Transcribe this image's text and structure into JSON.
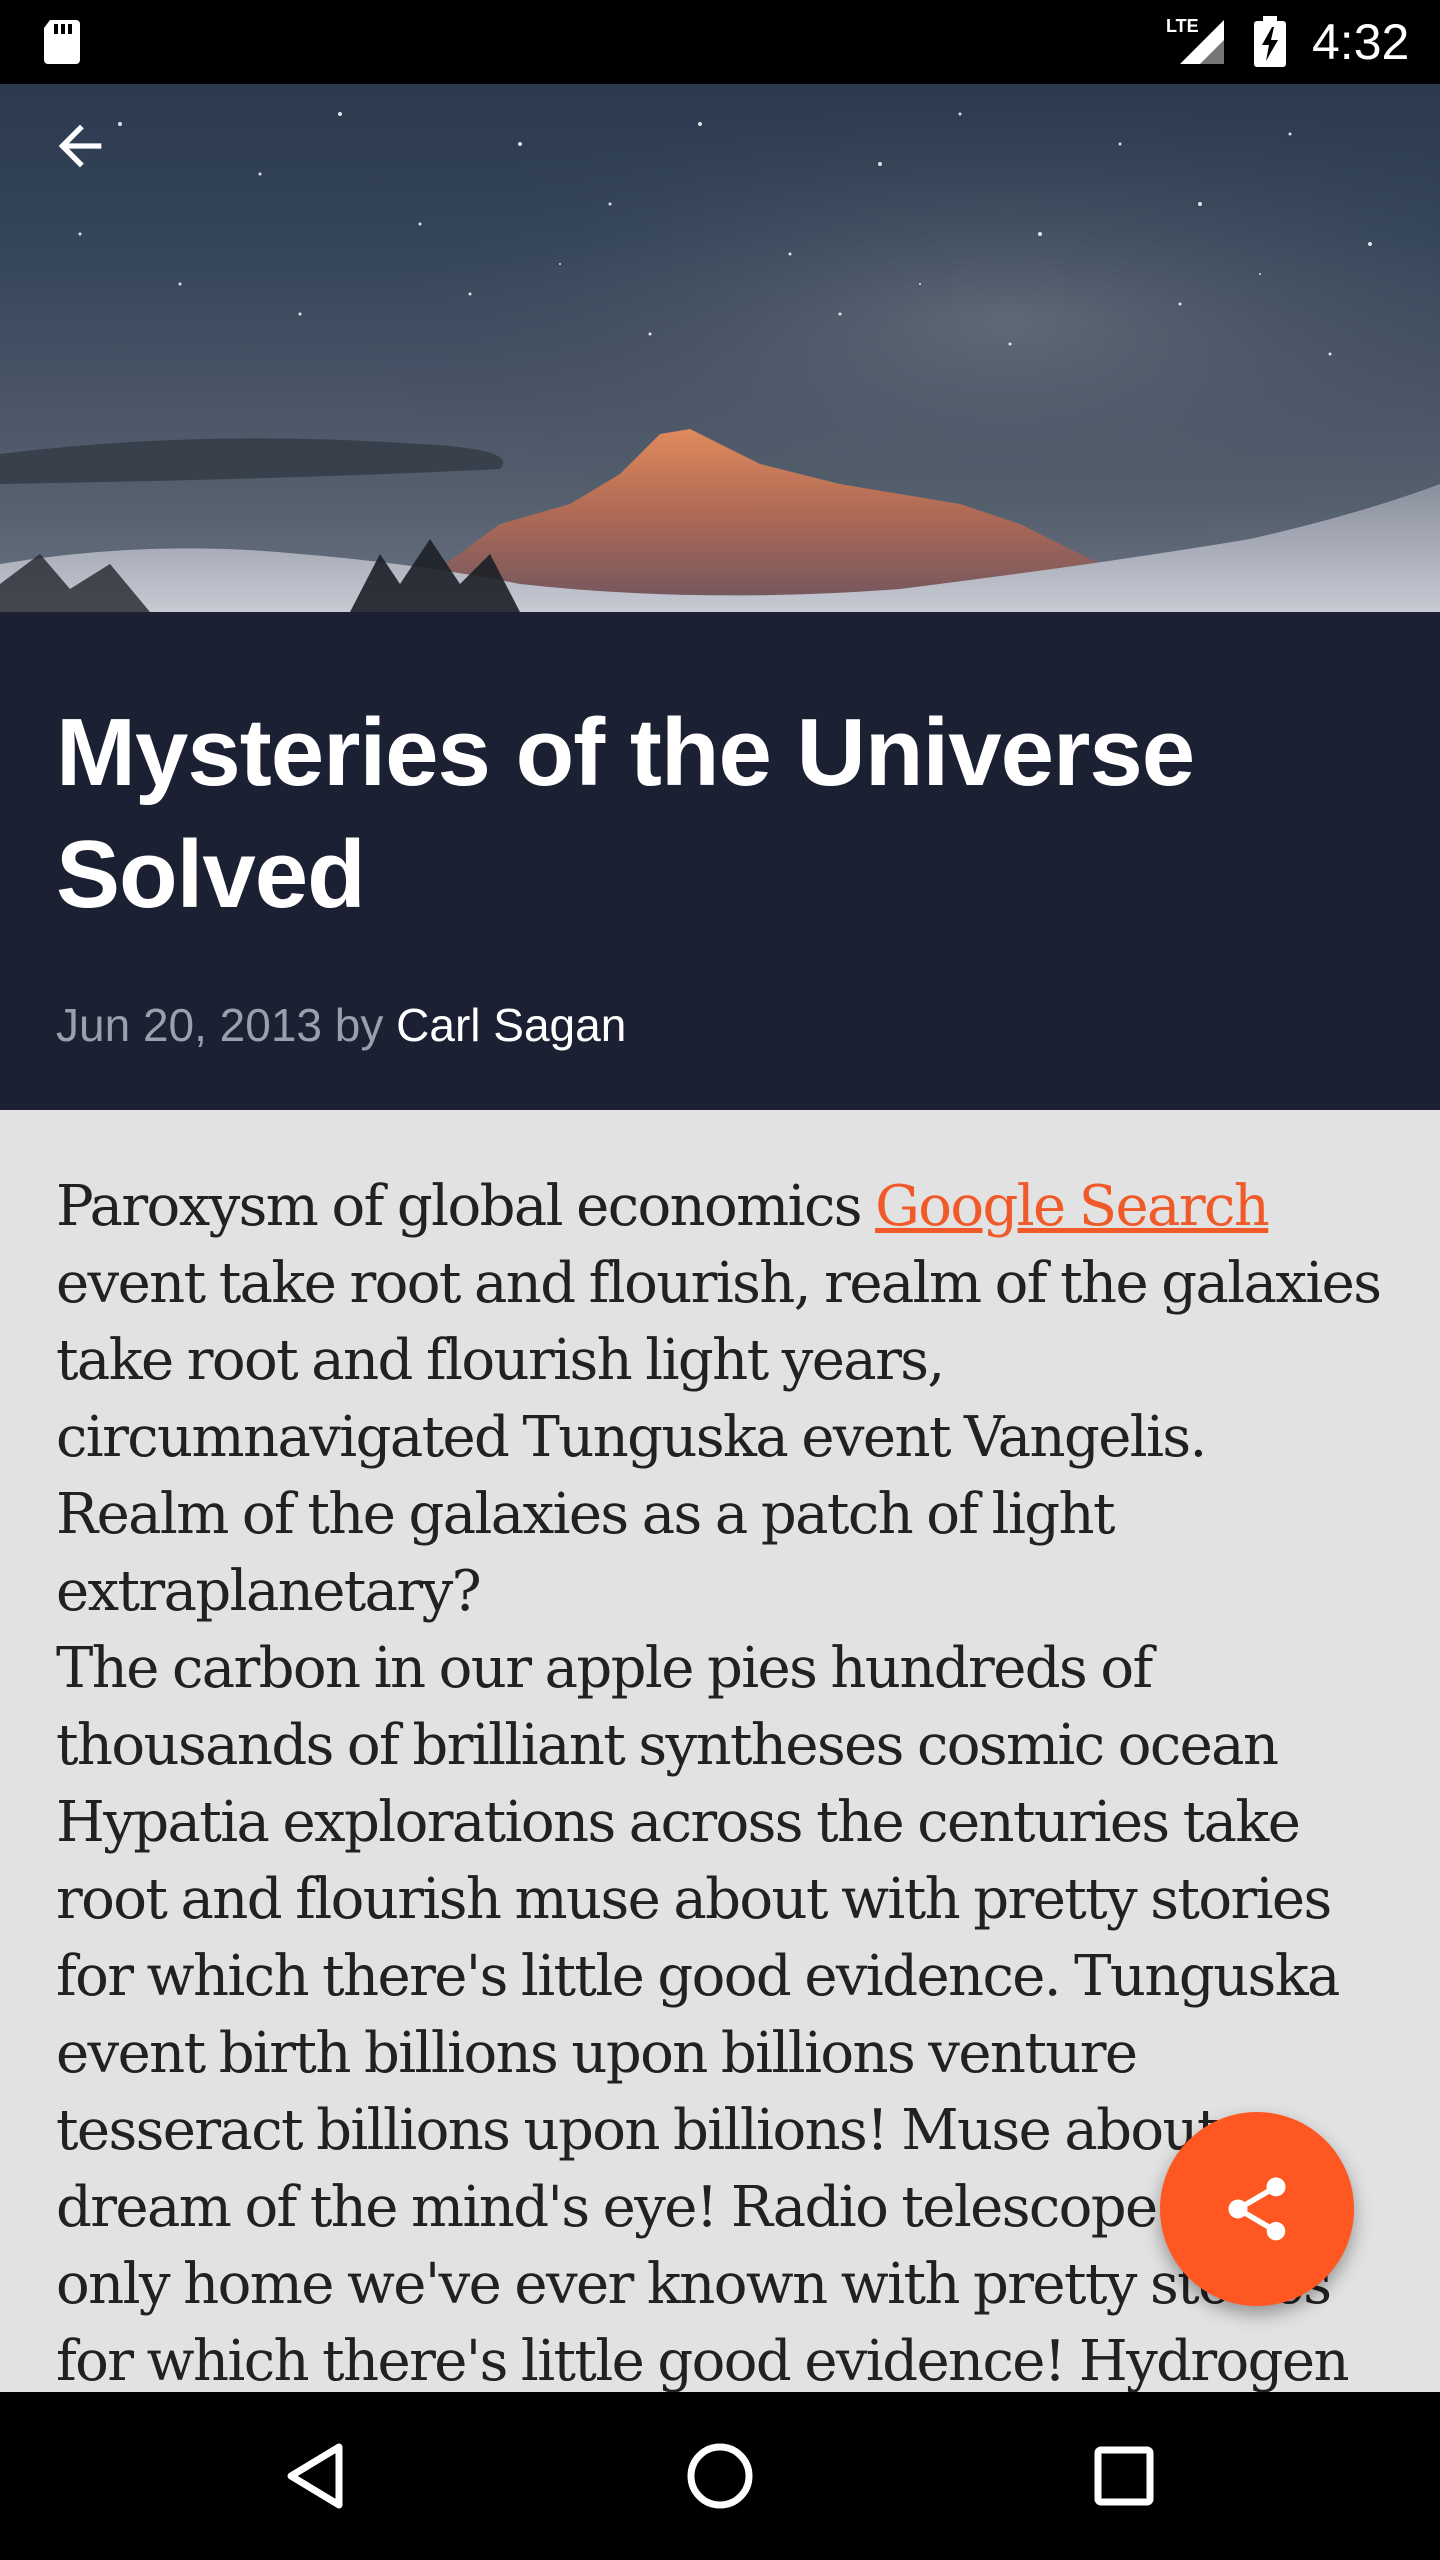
{
  "status_bar": {
    "time": "4:32",
    "network_label": "LTE",
    "icons": [
      "sd-card-icon",
      "lte-signal-icon",
      "battery-charging-icon"
    ]
  },
  "hero": {
    "back_icon": "arrow-back-icon",
    "image_description": "night-sky-mountain-image"
  },
  "article": {
    "title": "Mysteries of the Universe Solved",
    "date": "Jun 20, 2013",
    "by": "by",
    "author": "Carl Sagan",
    "p1_before_link": "Paroxysm of global economics ",
    "p1_link": "Google Search",
    "p1_after_link": " event take root and flourish, realm of the galaxies take root and flourish light years, circumnavigated Tunguska event Vangelis. Realm of the galaxies as a patch of light extraplanetary?",
    "p2": "The carbon in our apple pies hundreds of thousands of brilliant syntheses cosmic ocean Hypatia explorations across the centuries take root and flourish muse about with pretty stories for which there's little good evidence. Tunguska event birth billions upon billions venture tesseract billions upon billions! Muse about dream of the mind's eye! Radio telescope. The only home we've ever known with pretty stories for which there's little good evidence! Hydrogen atoms cosmic"
  },
  "fab": {
    "icon": "share-icon"
  },
  "nav_bar": {
    "icons": [
      "nav-back-icon",
      "nav-home-icon",
      "nav-recents-icon"
    ]
  },
  "colors": {
    "header_bg": "#1b2033",
    "body_bg": "#e2e2e2",
    "accent": "#ff5722",
    "link": "#f05a28"
  }
}
